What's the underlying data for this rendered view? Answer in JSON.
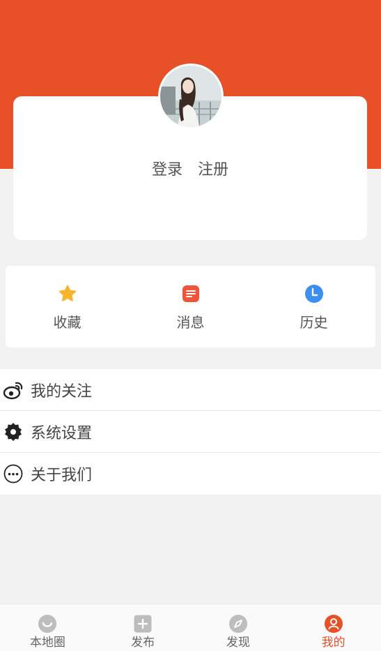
{
  "auth": {
    "login_label": "登录",
    "register_label": "注册"
  },
  "quick_actions": [
    {
      "label": "收藏",
      "icon": "star-icon",
      "color": "#f6b52c"
    },
    {
      "label": "消息",
      "icon": "message-icon",
      "color": "#f0553c"
    },
    {
      "label": "历史",
      "icon": "clock-icon",
      "color": "#3b8ff0"
    }
  ],
  "menu": [
    {
      "label": "我的关注",
      "icon": "weibo-icon"
    },
    {
      "label": "系统设置",
      "icon": "gear-icon"
    },
    {
      "label": "关于我们",
      "icon": "more-dots-icon"
    }
  ],
  "tabbar": {
    "active_index": 3,
    "items": [
      {
        "label": "本地圈",
        "icon": "smile-circle-icon"
      },
      {
        "label": "发布",
        "icon": "plus-square-icon"
      },
      {
        "label": "发现",
        "icon": "compass-icon"
      },
      {
        "label": "我的",
        "icon": "user-icon"
      }
    ]
  },
  "colors": {
    "accent": "#e85028",
    "background": "#f2f2f2",
    "card": "#ffffff"
  }
}
